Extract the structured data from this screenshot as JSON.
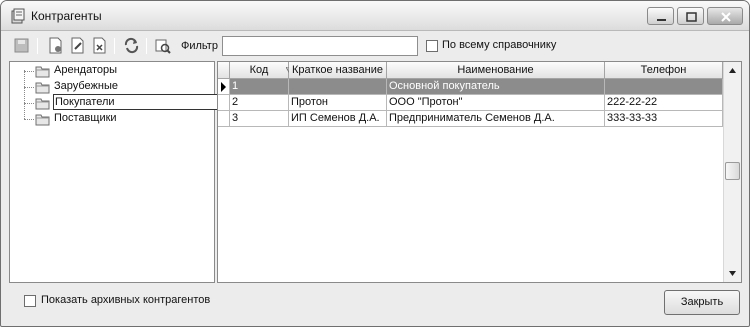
{
  "window": {
    "title": "Контрагенты"
  },
  "toolbar": {
    "buttons": [
      "save-icon",
      "new-document-icon",
      "edit-icon",
      "delete-icon",
      "refresh-icon",
      "print-preview-icon"
    ],
    "filter_label": "Фильтр",
    "filter_value": "",
    "search_all_label": "По всему справочнику",
    "search_all_checked": false
  },
  "tree": {
    "items": [
      {
        "label": "Арендаторы",
        "selected": false
      },
      {
        "label": "Зарубежные",
        "selected": false
      },
      {
        "label": "Покупатели",
        "selected": true
      },
      {
        "label": "Поставщики",
        "selected": false
      }
    ]
  },
  "grid": {
    "columns": [
      "Код",
      "Краткое название",
      "Наименование",
      "Телефон"
    ],
    "rows": [
      {
        "code": "1",
        "short_name": "",
        "name": "Основной покупатель",
        "phone": "",
        "selected": true
      },
      {
        "code": "2",
        "short_name": "Протон",
        "name": "ООО \"Протон\"",
        "phone": "222-22-22",
        "selected": false
      },
      {
        "code": "3",
        "short_name": "ИП Семенов Д.А.",
        "name": "Предприниматель Семенов Д.А.",
        "phone": "333-33-33",
        "selected": false
      }
    ]
  },
  "footer": {
    "show_archived_label": "Показать архивных контрагентов",
    "show_archived_checked": false,
    "close_label": "Закрыть"
  },
  "colors": {
    "selection": "#8c8c8c",
    "window_bg": "#ececec"
  }
}
